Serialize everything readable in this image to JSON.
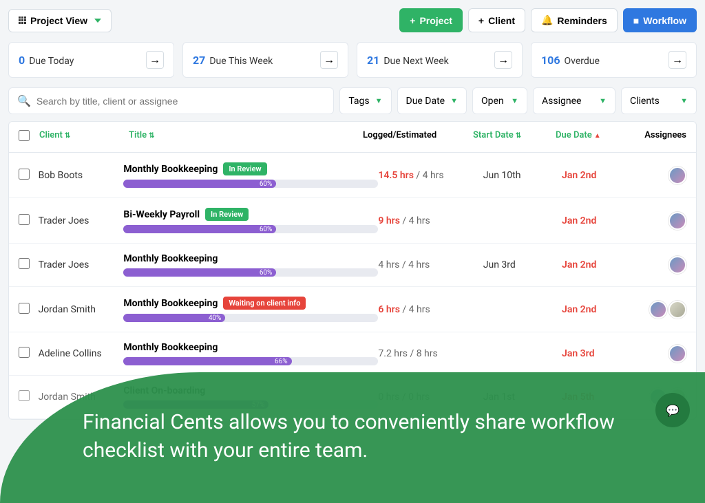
{
  "toolbar": {
    "view_label": "Project View",
    "project_btn": "Project",
    "client_btn": "Client",
    "reminders_btn": "Reminders",
    "workflow_btn": "Workflow"
  },
  "summary": [
    {
      "count": "0",
      "label": "Due Today"
    },
    {
      "count": "27",
      "label": "Due This Week"
    },
    {
      "count": "21",
      "label": "Due Next Week"
    },
    {
      "count": "106",
      "label": "Overdue"
    }
  ],
  "search": {
    "placeholder": "Search by title, client or assignee"
  },
  "filters": [
    {
      "label": "Tags"
    },
    {
      "label": "Due Date"
    },
    {
      "label": "Open"
    },
    {
      "label": "Assignee"
    },
    {
      "label": "Clients"
    }
  ],
  "columns": {
    "client": "Client",
    "title": "Title",
    "logged": "Logged/Estimated",
    "start": "Start Date",
    "due": "Due Date",
    "assignees": "Assignees"
  },
  "rows": [
    {
      "client": "Bob Boots",
      "title": "Monthly Bookkeeping",
      "badge": "In Review",
      "badge_type": "green",
      "progress": 60,
      "logged": "14.5 hrs",
      "estimated": "4 hrs",
      "over": true,
      "start": "Jun 10th",
      "due": "Jan 2nd",
      "avatars": 1
    },
    {
      "client": "Trader Joes",
      "title": "Bi-Weekly Payroll",
      "badge": "In Review",
      "badge_type": "green",
      "progress": 60,
      "logged": "9 hrs",
      "estimated": "4 hrs",
      "over": true,
      "start": "",
      "due": "Jan 2nd",
      "avatars": 1
    },
    {
      "client": "Trader Joes",
      "title": "Monthly Bookkeeping",
      "badge": "",
      "badge_type": "",
      "progress": 60,
      "logged": "4 hrs",
      "estimated": "4 hrs",
      "over": false,
      "start": "Jun 3rd",
      "due": "Jan 2nd",
      "avatars": 1
    },
    {
      "client": "Jordan Smith",
      "title": "Monthly Bookkeeping",
      "badge": "Waiting on client info",
      "badge_type": "red",
      "progress": 40,
      "logged": "6 hrs",
      "estimated": "4 hrs",
      "over": true,
      "start": "",
      "due": "Jan 2nd",
      "avatars": 2
    },
    {
      "client": "Adeline Collins",
      "title": "Monthly Bookkeeping",
      "badge": "",
      "badge_type": "",
      "progress": 66,
      "logged": "7.2 hrs",
      "estimated": "8 hrs",
      "over": false,
      "start": "",
      "due": "Jan 3rd",
      "avatars": 1
    },
    {
      "client": "Jordan Smith",
      "title": "Client On-boarding",
      "badge": "",
      "badge_type": "",
      "progress": 57,
      "logged": "0 hrs",
      "estimated": "0 hrs",
      "over": false,
      "start": "Jan 1st",
      "due": "Jan 5th",
      "avatars": 2
    }
  ],
  "overlay": {
    "text": "Financial Cents allows you to conveniently share workflow checklist with your entire team."
  }
}
